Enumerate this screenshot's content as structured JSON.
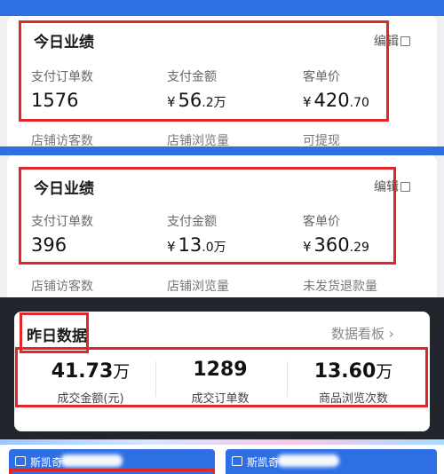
{
  "panel1": {
    "title": "今日业绩",
    "edit": "编辑",
    "metrics": [
      {
        "label": "支付订单数",
        "value": "1576"
      },
      {
        "label": "支付金额",
        "currency": "¥",
        "value": "56",
        "decimals": ".2",
        "unit": "万"
      },
      {
        "label": "客单价",
        "currency": "¥",
        "value": "420",
        "decimals": ".70"
      }
    ],
    "sub_labels": [
      "店铺访客数",
      "店铺浏览量",
      "可提现"
    ]
  },
  "panel2": {
    "title": "今日业绩",
    "edit": "编辑",
    "metrics": [
      {
        "label": "支付订单数",
        "value": "396"
      },
      {
        "label": "支付金额",
        "currency": "¥",
        "value": "13",
        "decimals": ".0",
        "unit": "万"
      },
      {
        "label": "客单价",
        "currency": "¥",
        "value": "360",
        "decimals": ".29"
      }
    ],
    "sub_labels": [
      "店铺访客数",
      "店铺浏览量",
      "未发货退款量"
    ]
  },
  "panel3": {
    "title": "昨日数据",
    "link": "数据看板",
    "metrics": [
      {
        "value": "41.73",
        "unit": "万",
        "label": "成交金额(元)"
      },
      {
        "value": "1289",
        "unit": "",
        "label": "成交订单数"
      },
      {
        "value": "13.60",
        "unit": "万",
        "label": "商品浏览次数"
      }
    ]
  },
  "panel4": {
    "shops": [
      {
        "name": "斯凯奇"
      },
      {
        "name": "斯凯奇"
      }
    ]
  },
  "colors": {
    "brand_blue": "#2f6fe4",
    "highlight_red": "#e0262b",
    "dark_bg": "#22252c"
  }
}
